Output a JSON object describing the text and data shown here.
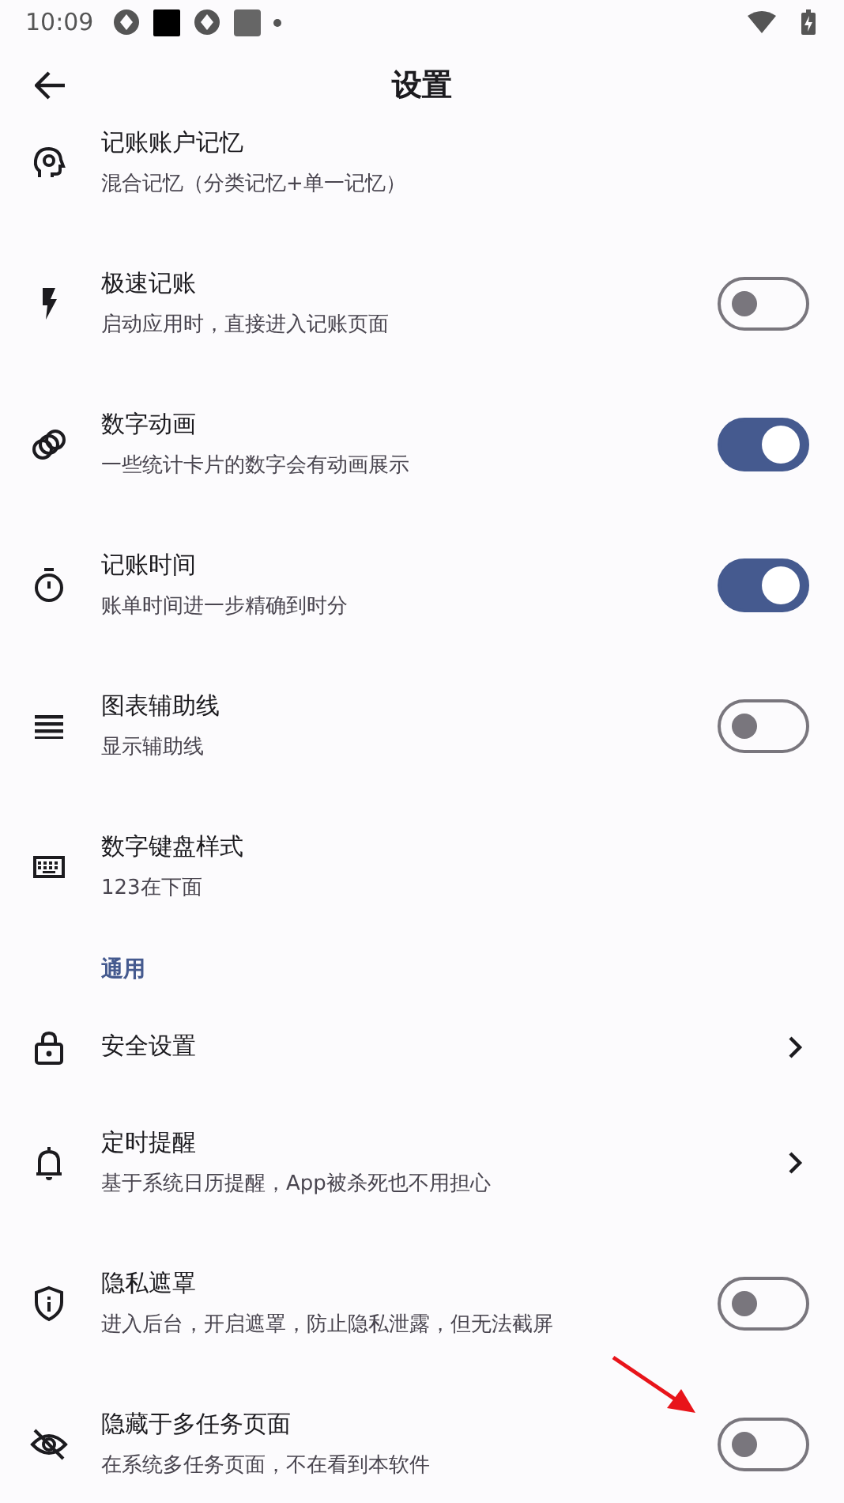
{
  "status_bar": {
    "time": "10:09"
  },
  "app_bar": {
    "title": "设置"
  },
  "items": [
    {
      "title": "记账账户记忆",
      "subtitle": "混合记忆（分类记忆+单一记忆）",
      "kind": "plain"
    },
    {
      "title": "极速记账",
      "subtitle": "启动应用时，直接进入记账页面",
      "kind": "toggle",
      "on": false
    },
    {
      "title": "数字动画",
      "subtitle": "一些统计卡片的数字会有动画展示",
      "kind": "toggle",
      "on": true
    },
    {
      "title": "记账时间",
      "subtitle": "账单时间进一步精确到时分",
      "kind": "toggle",
      "on": true
    },
    {
      "title": "图表辅助线",
      "subtitle": "显示辅助线",
      "kind": "toggle",
      "on": false
    },
    {
      "title": "数字键盘样式",
      "subtitle": "123在下面",
      "kind": "plain"
    },
    {
      "title": "通用",
      "kind": "header"
    },
    {
      "title": "安全设置",
      "kind": "link"
    },
    {
      "title": "定时提醒",
      "subtitle": "基于系统日历提醒，App被杀死也不用担心",
      "kind": "link"
    },
    {
      "title": "隐私遮罩",
      "subtitle": "进入后台，开启遮罩，防止隐私泄露，但无法截屏",
      "kind": "toggle",
      "on": false
    },
    {
      "title": "隐藏于多任务页面",
      "subtitle": "在系统多任务页面，不在看到本软件",
      "kind": "toggle",
      "on": false
    }
  ]
}
